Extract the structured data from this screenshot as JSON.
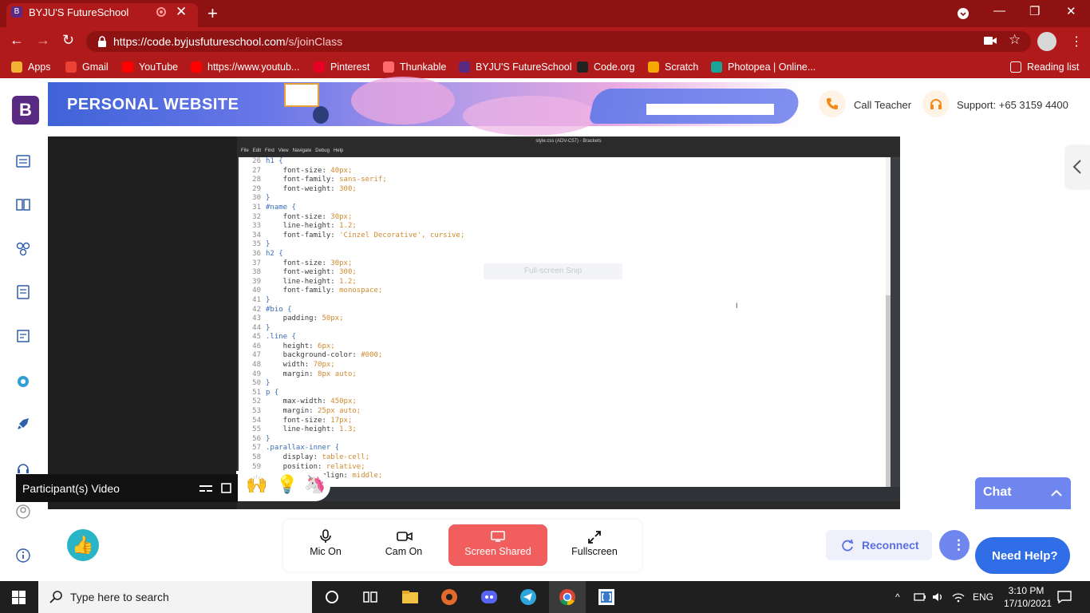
{
  "browser": {
    "tab_title": "BYJU'S FutureSchool",
    "tab_favicon": "B",
    "new_tab": "+",
    "url_host": "https://code.byjusfutureschool.com",
    "url_path": "/s/joinClass",
    "window_min": "—",
    "window_max": "❐",
    "window_close": "✕",
    "tab_close": "✕",
    "nav_back": "←",
    "nav_forward": "→",
    "nav_reload": "↻",
    "bookmark_star": "☆",
    "bookmarks": [
      {
        "label": "Apps",
        "color": "#f2b233"
      },
      {
        "label": "Gmail",
        "color": "#ea4335"
      },
      {
        "label": "YouTube",
        "color": "#ff0000"
      },
      {
        "label": "https://www.youtub...",
        "color": "#ff0000"
      },
      {
        "label": "Pinterest",
        "color": "#e60023"
      },
      {
        "label": "Thunkable",
        "color": "#ff6b6b"
      },
      {
        "label": "BYJU'S FutureSchool",
        "color": "#5a2a82"
      },
      {
        "label": "Code.org",
        "color": "#222222"
      },
      {
        "label": "Scratch",
        "color": "#f7a700"
      },
      {
        "label": "Photopea | Online...",
        "color": "#18a497"
      }
    ],
    "reading_list": "Reading list"
  },
  "header": {
    "logo": "B",
    "title": "PERSONAL WEBSITE",
    "call_teacher": "Call Teacher",
    "support": "Support: +65 3159 4400"
  },
  "editor": {
    "window_title": "style.css (ADV-C57) - Brackets",
    "menu": [
      "File",
      "Edit",
      "Find",
      "View",
      "Navigate",
      "Debug",
      "Help"
    ],
    "hint": "Full-screen Snip",
    "lines": [
      {
        "n": "26",
        "t": "h1 {",
        "k": "sel"
      },
      {
        "n": "27",
        "t": "    font-size: 40px;",
        "k": "prop"
      },
      {
        "n": "28",
        "t": "    font-family: sans-serif;",
        "k": "prop"
      },
      {
        "n": "29",
        "t": "    font-weight: 300;",
        "k": "prop"
      },
      {
        "n": "30",
        "t": "}",
        "k": "sel"
      },
      {
        "n": "31",
        "t": "#name {",
        "k": "sel"
      },
      {
        "n": "32",
        "t": "    font-size: 30px;",
        "k": "prop"
      },
      {
        "n": "33",
        "t": "    line-height: 1.2;",
        "k": "prop"
      },
      {
        "n": "34",
        "t": "    font-family: 'Cinzel Decorative', cursive;",
        "k": "prop"
      },
      {
        "n": "35",
        "t": "}",
        "k": "sel"
      },
      {
        "n": "36",
        "t": "h2 {",
        "k": "sel"
      },
      {
        "n": "37",
        "t": "    font-size: 30px;",
        "k": "prop"
      },
      {
        "n": "38",
        "t": "    font-weight: 300;",
        "k": "prop"
      },
      {
        "n": "39",
        "t": "    line-height: 1.2;",
        "k": "prop"
      },
      {
        "n": "40",
        "t": "    font-family: monospace;",
        "k": "prop"
      },
      {
        "n": "41",
        "t": "}",
        "k": "sel"
      },
      {
        "n": "42",
        "t": "#bio {",
        "k": "sel"
      },
      {
        "n": "43",
        "t": "    padding: 50px;",
        "k": "prop"
      },
      {
        "n": "44",
        "t": "}",
        "k": "sel"
      },
      {
        "n": "45",
        "t": ".line {",
        "k": "sel"
      },
      {
        "n": "46",
        "t": "    height: 6px;",
        "k": "prop"
      },
      {
        "n": "47",
        "t": "    background-color: #000;",
        "k": "prop"
      },
      {
        "n": "48",
        "t": "    width: 70px;",
        "k": "prop"
      },
      {
        "n": "49",
        "t": "    margin: 8px auto;",
        "k": "prop"
      },
      {
        "n": "50",
        "t": "}",
        "k": "sel"
      },
      {
        "n": "51",
        "t": "p {",
        "k": "sel"
      },
      {
        "n": "52",
        "t": "    max-width: 450px;",
        "k": "prop"
      },
      {
        "n": "53",
        "t": "    margin: 25px auto;",
        "k": "prop"
      },
      {
        "n": "54",
        "t": "    font-size: 17px;",
        "k": "prop"
      },
      {
        "n": "55",
        "t": "    line-height: 1.3;",
        "k": "prop"
      },
      {
        "n": "56",
        "t": "}",
        "k": "sel"
      },
      {
        "n": "57",
        "t": ".parallax-inner {",
        "k": "sel"
      },
      {
        "n": "58",
        "t": "    display: table-cell;",
        "k": "prop"
      },
      {
        "n": "59",
        "t": "    position: relative;",
        "k": "prop"
      },
      {
        "n": "60",
        "t": "    vertical-align: middle;",
        "k": "prop"
      }
    ]
  },
  "participants": {
    "label": "Participant(s) Video",
    "reactions": [
      "🙌",
      "💡",
      "🦄"
    ]
  },
  "chat": {
    "label": "Chat"
  },
  "controls": {
    "mic": "Mic On",
    "cam": "Cam On",
    "screen": "Screen Shared",
    "fullscreen": "Fullscreen",
    "reconnect": "Reconnect",
    "help": "Need Help?",
    "like": "👍"
  },
  "taskbar": {
    "search_placeholder": "Type here to search",
    "lang": "ENG",
    "time": "3:10 PM",
    "date": "17/10/2021"
  },
  "colors": {
    "chrome_red": "#b01a1a",
    "brand_purple": "#5a2a82",
    "accent_blue": "#6f86ee",
    "screen_shared_red": "#f15e5e"
  }
}
